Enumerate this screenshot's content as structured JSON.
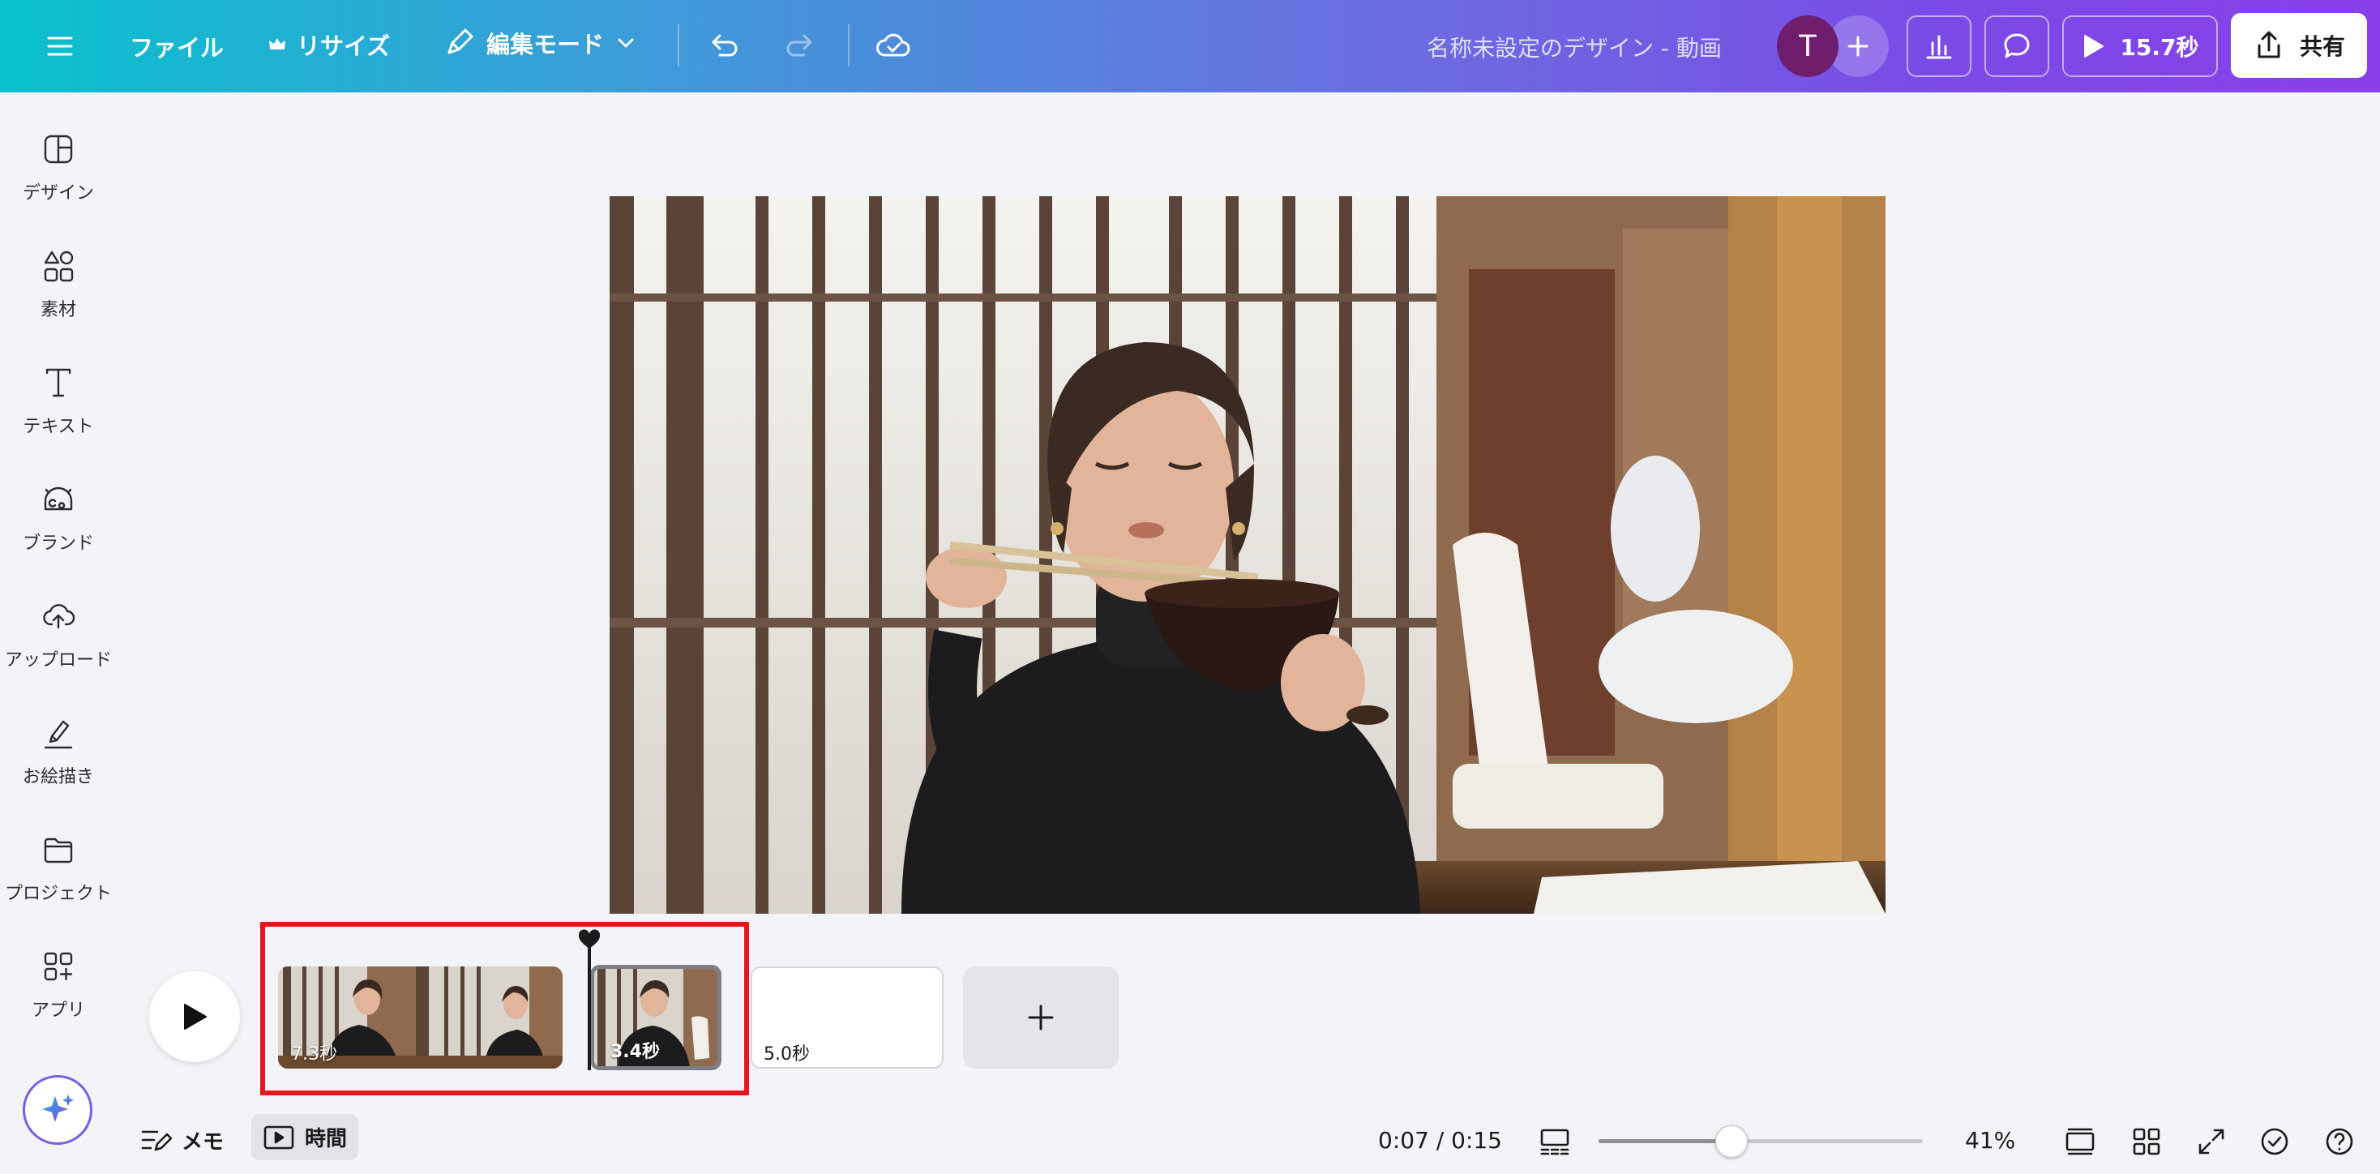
{
  "topbar": {
    "file_label": "ファイル",
    "resize_label": "リサイズ",
    "edit_mode_label": "編集モード",
    "document_title": "名称未設定のデザイン - 動画",
    "avatar_initial": "T",
    "present_duration": "15.7秒",
    "share_label": "共有"
  },
  "sidebar": {
    "items": [
      {
        "label": "デザイン",
        "icon": "layout-icon"
      },
      {
        "label": "素材",
        "icon": "shapes-icon"
      },
      {
        "label": "テキスト",
        "icon": "text-icon"
      },
      {
        "label": "ブランド",
        "icon": "brand-icon"
      },
      {
        "label": "アップロード",
        "icon": "upload-cloud-icon"
      },
      {
        "label": "お絵描き",
        "icon": "draw-icon"
      },
      {
        "label": "プロジェクト",
        "icon": "folder-icon"
      },
      {
        "label": "アプリ",
        "icon": "apps-icon"
      }
    ]
  },
  "timeline": {
    "clips": [
      {
        "duration": "7.3秒"
      },
      {
        "duration": "3.4秒"
      },
      {
        "duration": "5.0秒"
      }
    ]
  },
  "bottombar": {
    "notes_label": "メモ",
    "time_label": "時間",
    "time_readout": "0:07 / 0:15",
    "zoom_percent": "41%",
    "zoom_level": 0.41
  },
  "colors": {
    "gradient_start": "#09c1cd",
    "gradient_end": "#8a3fe8",
    "highlight": "#e8161c",
    "avatar": "#6e1e6d"
  }
}
